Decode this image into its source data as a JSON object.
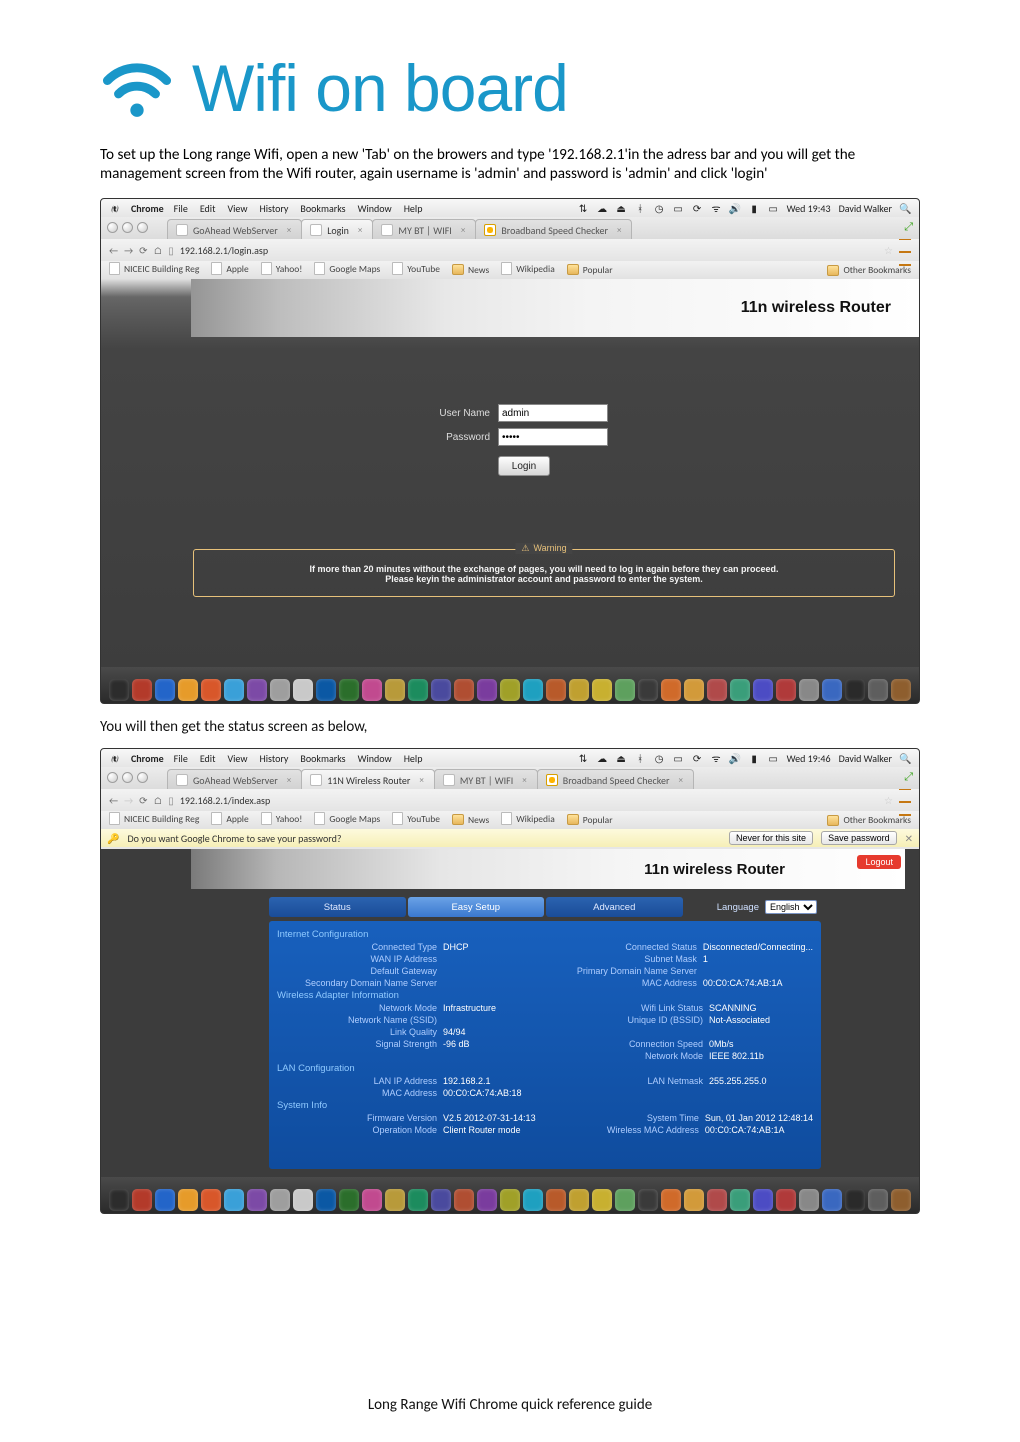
{
  "logo_text": "Wifi on board",
  "intro": {
    "p1": "To set up the Long range Wifi, open a new 'Tab' on the browers and type '192.168.2.1'in the adress bar and you will get the management screen from the Wifi router, again username is 'admin' and password is 'admin' and click 'login'"
  },
  "mac_menubar": {
    "app": "Chrome",
    "items": [
      "File",
      "Edit",
      "View",
      "History",
      "Bookmarks",
      "Window",
      "Help"
    ],
    "time": "Wed 19:43",
    "user": "David Walker"
  },
  "tabs1": [
    {
      "label": "GoAhead WebServer",
      "active": false
    },
    {
      "label": "Login",
      "active": true
    },
    {
      "label": "MY BT | WIFI",
      "active": false
    },
    {
      "label": "Broadband Speed Checker",
      "active": false,
      "speed": true
    }
  ],
  "url1": "192.168.2.1/login.asp",
  "bookmarks": [
    {
      "label": "NICEIC Building Reg",
      "type": "page"
    },
    {
      "label": "Apple",
      "type": "page"
    },
    {
      "label": "Yahoo!",
      "type": "page"
    },
    {
      "label": "Google Maps",
      "type": "page"
    },
    {
      "label": "YouTube",
      "type": "page"
    },
    {
      "label": "News",
      "type": "folder"
    },
    {
      "label": "Wikipedia",
      "type": "page"
    },
    {
      "label": "Popular",
      "type": "folder"
    }
  ],
  "other_bookmarks": "Other Bookmarks",
  "router_title": "11n wireless Router",
  "login": {
    "username_label": "User Name",
    "password_label": "Password",
    "username_value": "admin",
    "password_value": "•••••",
    "login_btn": "Login"
  },
  "warning": {
    "legend": "Warning",
    "line1": "If more than 20 minutes without the exchange of pages, you will need to log in again before they can proceed.",
    "line2": "Please keyin the administrator account and password to enter the system."
  },
  "midline": "You will then get the status screen as below,",
  "mac_menubar2_time": "Wed 19:46",
  "tabs2": [
    {
      "label": "GoAhead WebServer",
      "active": false
    },
    {
      "label": "11N Wireless Router",
      "active": true
    },
    {
      "label": "MY BT | WIFI",
      "active": false
    },
    {
      "label": "Broadband Speed Checker",
      "active": false,
      "speed": true
    }
  ],
  "url2": "192.168.2.1/index.asp",
  "pwbar": {
    "text": "Do you want Google Chrome to save your password?",
    "never": "Never for this site",
    "save": "Save password"
  },
  "logout": "Logout",
  "navrow": {
    "status": "Status",
    "easy": "Easy Setup",
    "adv": "Advanced",
    "lang_label": "Language",
    "lang_value": "English"
  },
  "status_sections": {
    "internet": {
      "hdr": "Internet Configuration",
      "rows": [
        [
          "Connected Type",
          "DHCP",
          "Connected Status",
          "Disconnected/Connecting..."
        ],
        [
          "WAN IP Address",
          "",
          "Subnet Mask",
          "1"
        ],
        [
          "Default Gateway",
          "",
          "Primary Domain Name Server",
          ""
        ],
        [
          "Secondary Domain Name Server",
          "",
          "MAC Address",
          "00:C0:CA:74:AB:1A"
        ]
      ]
    },
    "wifi": {
      "hdr": "Wireless Adapter Information",
      "rows": [
        [
          "Network Mode",
          "Infrastructure",
          "Wifi Link Status",
          "SCANNING"
        ],
        [
          "Network Name (SSID)",
          "",
          "Unique ID (BSSID)",
          "Not-Associated"
        ],
        [
          "Link Quality",
          "94/94",
          "",
          ""
        ],
        [
          "Signal Strength",
          "-96 dB",
          "Connection Speed",
          "0Mb/s"
        ],
        [
          "",
          "",
          "Network Mode",
          "IEEE 802.11b"
        ]
      ]
    },
    "lan": {
      "hdr": "LAN Configuration",
      "rows": [
        [
          "LAN IP Address",
          "192.168.2.1",
          "LAN Netmask",
          "255.255.255.0"
        ],
        [
          "MAC Address",
          "00:C0:CA:74:AB:18",
          "",
          ""
        ]
      ]
    },
    "sys": {
      "hdr": "System Info",
      "rows": [
        [
          "Firmware Version",
          "V2.5  2012-07-31-14:13",
          "System Time",
          "Sun, 01 Jan 2012 12:48:14"
        ],
        [
          "Operation Mode",
          "Client Router mode",
          "Wireless MAC Address",
          "00:C0:CA:74:AB:1A"
        ]
      ]
    }
  },
  "footer": "Long Range Wifi  Chrome quick reference guide",
  "dock_colors": [
    "#2c2c2c",
    "#b33a2a",
    "#2365c9",
    "#e69b2a",
    "#d8572a",
    "#3aa0d8",
    "#7c4aa6",
    "#9e9e9e",
    "#c9c9c9",
    "#0b58a4",
    "#2b6e2b",
    "#c14a8f",
    "#b89a3a",
    "#1c8c5e",
    "#4a4a9e",
    "#b04e32",
    "#7a3c9e",
    "#a0a028",
    "#1ea0c0",
    "#b85a2a",
    "#c0a030",
    "#c8b030",
    "#5ea05e",
    "#3a3a3a",
    "#d06a2a",
    "#d29a3a",
    "#b04a4a",
    "#3a9e7a",
    "#4c4cc4",
    "#b03a3a",
    "#888",
    "#3a68c0",
    "#2a2a2a",
    "#5e5e5e",
    "#8e5e2e"
  ]
}
